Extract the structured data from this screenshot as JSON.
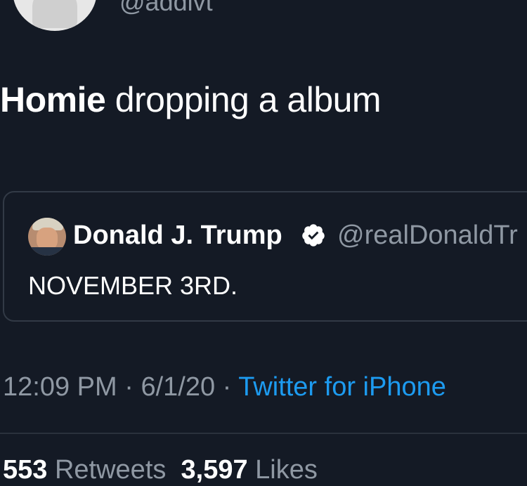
{
  "author": {
    "handle": "@addivt",
    "avatar_icon": "profile-avatar"
  },
  "tweet": {
    "mention": "Homie",
    "text": " dropping a album"
  },
  "quoted_tweet": {
    "name": "Donald J. Trump",
    "verified_icon": "verified-badge-icon",
    "handle": "@realDonaldTr",
    "text": "NOVEMBER 3RD."
  },
  "meta": {
    "time": "12:09 PM",
    "sep1": " · ",
    "date": "6/1/20",
    "sep2": " · ",
    "source": "Twitter for iPhone"
  },
  "stats": {
    "retweets_count": "553",
    "retweets_label": "Retweets",
    "likes_count": "3,597",
    "likes_label": "Likes"
  },
  "colors": {
    "background": "#141a25",
    "link": "#1d9bf0",
    "muted": "#8f98a3"
  }
}
